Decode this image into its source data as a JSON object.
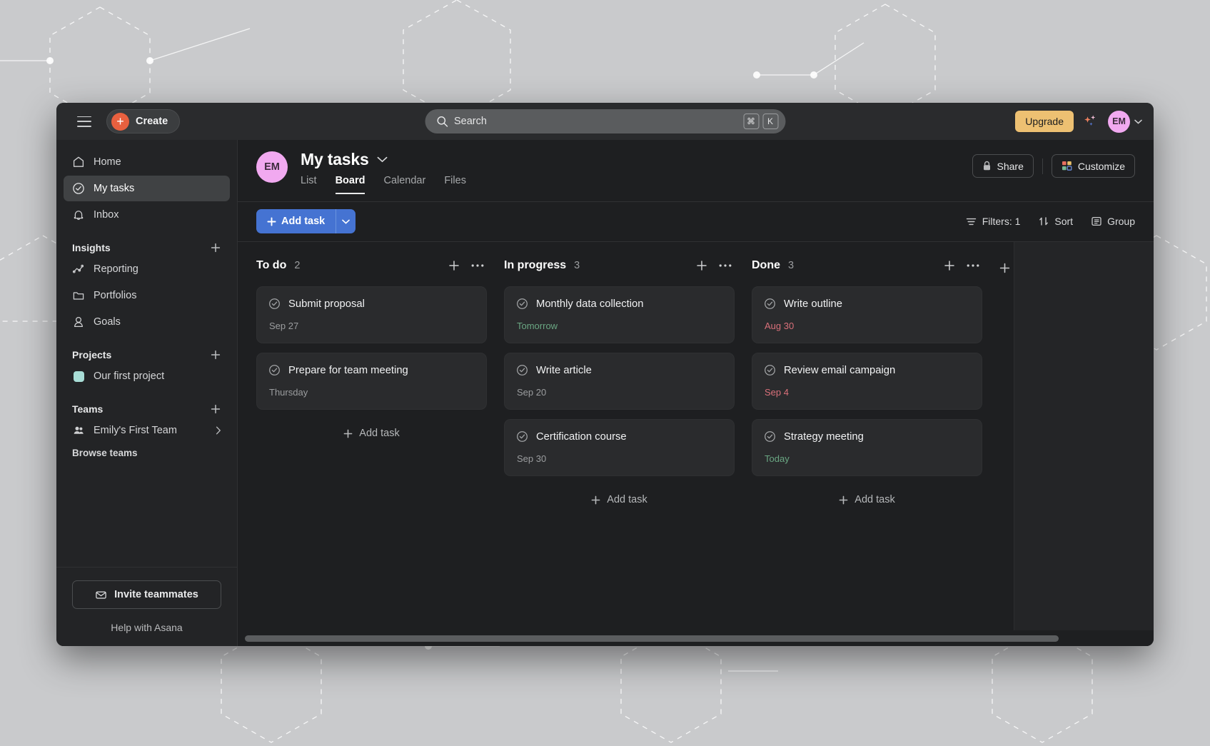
{
  "topbar": {
    "menu_icon": "hamburger-icon",
    "create_label": "Create",
    "search_placeholder": "Search",
    "search_value": "",
    "shortcut_keys": [
      "⌘",
      "K"
    ],
    "upgrade_label": "Upgrade",
    "ai_icon": "sparkle-icon",
    "avatar_initials": "EM"
  },
  "sidebar": {
    "primary": [
      {
        "label": "Home",
        "icon": "home-icon",
        "active": false
      },
      {
        "label": "My tasks",
        "icon": "check-circle-icon",
        "active": true
      },
      {
        "label": "Inbox",
        "icon": "bell-icon",
        "active": false
      }
    ],
    "insights": {
      "title": "Insights",
      "add_icon": "plus-icon",
      "items": [
        {
          "label": "Reporting",
          "icon": "chart-line-icon"
        },
        {
          "label": "Portfolios",
          "icon": "folder-icon"
        },
        {
          "label": "Goals",
          "icon": "goal-icon"
        }
      ]
    },
    "projects": {
      "title": "Projects",
      "add_icon": "plus-icon",
      "items": [
        {
          "label": "Our first project",
          "color": "#a8ddd6"
        }
      ]
    },
    "teams": {
      "title": "Teams",
      "add_icon": "plus-icon",
      "items": [
        {
          "label": "Emily's First Team",
          "icon": "people-icon"
        }
      ],
      "browse_label": "Browse teams"
    },
    "invite_label": "Invite teammates",
    "help_label": "Help with Asana"
  },
  "page": {
    "avatar_initials": "EM",
    "title": "My tasks",
    "title_caret": "chevron-down-icon",
    "tabs": [
      {
        "label": "List",
        "active": false
      },
      {
        "label": "Board",
        "active": true
      },
      {
        "label": "Calendar",
        "active": false
      },
      {
        "label": "Files",
        "active": false
      }
    ],
    "share_label": "Share",
    "customize_label": "Customize"
  },
  "toolbar": {
    "add_task_label": "Add task",
    "filters_label": "Filters: 1",
    "sort_label": "Sort",
    "group_label": "Group",
    "add_section_label": "Add section",
    "column_add_task_label": "Add task"
  },
  "board": {
    "columns": [
      {
        "name": "To do",
        "count": "2",
        "show_add_task": true,
        "cards": [
          {
            "title": "Submit proposal",
            "date": "Sep 27",
            "date_state": "gray"
          },
          {
            "title": "Prepare for team meeting",
            "date": "Thursday",
            "date_state": "gray"
          }
        ]
      },
      {
        "name": "In progress",
        "count": "3",
        "show_add_task": true,
        "cards": [
          {
            "title": "Monthly data collection",
            "date": "Tomorrow",
            "date_state": "green"
          },
          {
            "title": "Write article",
            "date": "Sep 20",
            "date_state": "gray"
          },
          {
            "title": "Certification course",
            "date": "Sep 30",
            "date_state": "gray"
          }
        ]
      },
      {
        "name": "Done",
        "count": "3",
        "show_add_task": true,
        "cards": [
          {
            "title": "Write outline",
            "date": "Aug 30",
            "date_state": "red"
          },
          {
            "title": "Review email campaign",
            "date": "Sep 4",
            "date_state": "red"
          },
          {
            "title": "Strategy meeting",
            "date": "Today",
            "date_state": "green"
          }
        ]
      }
    ]
  },
  "colors": {
    "accent_blue": "#4573d2",
    "create_orange": "#e8603f",
    "upgrade_yellow": "#edc072",
    "avatar_pink": "#f1a9f0",
    "project_teal": "#a8ddd6",
    "overdue_red": "#d9707a",
    "upcoming_green": "#6aa783"
  }
}
